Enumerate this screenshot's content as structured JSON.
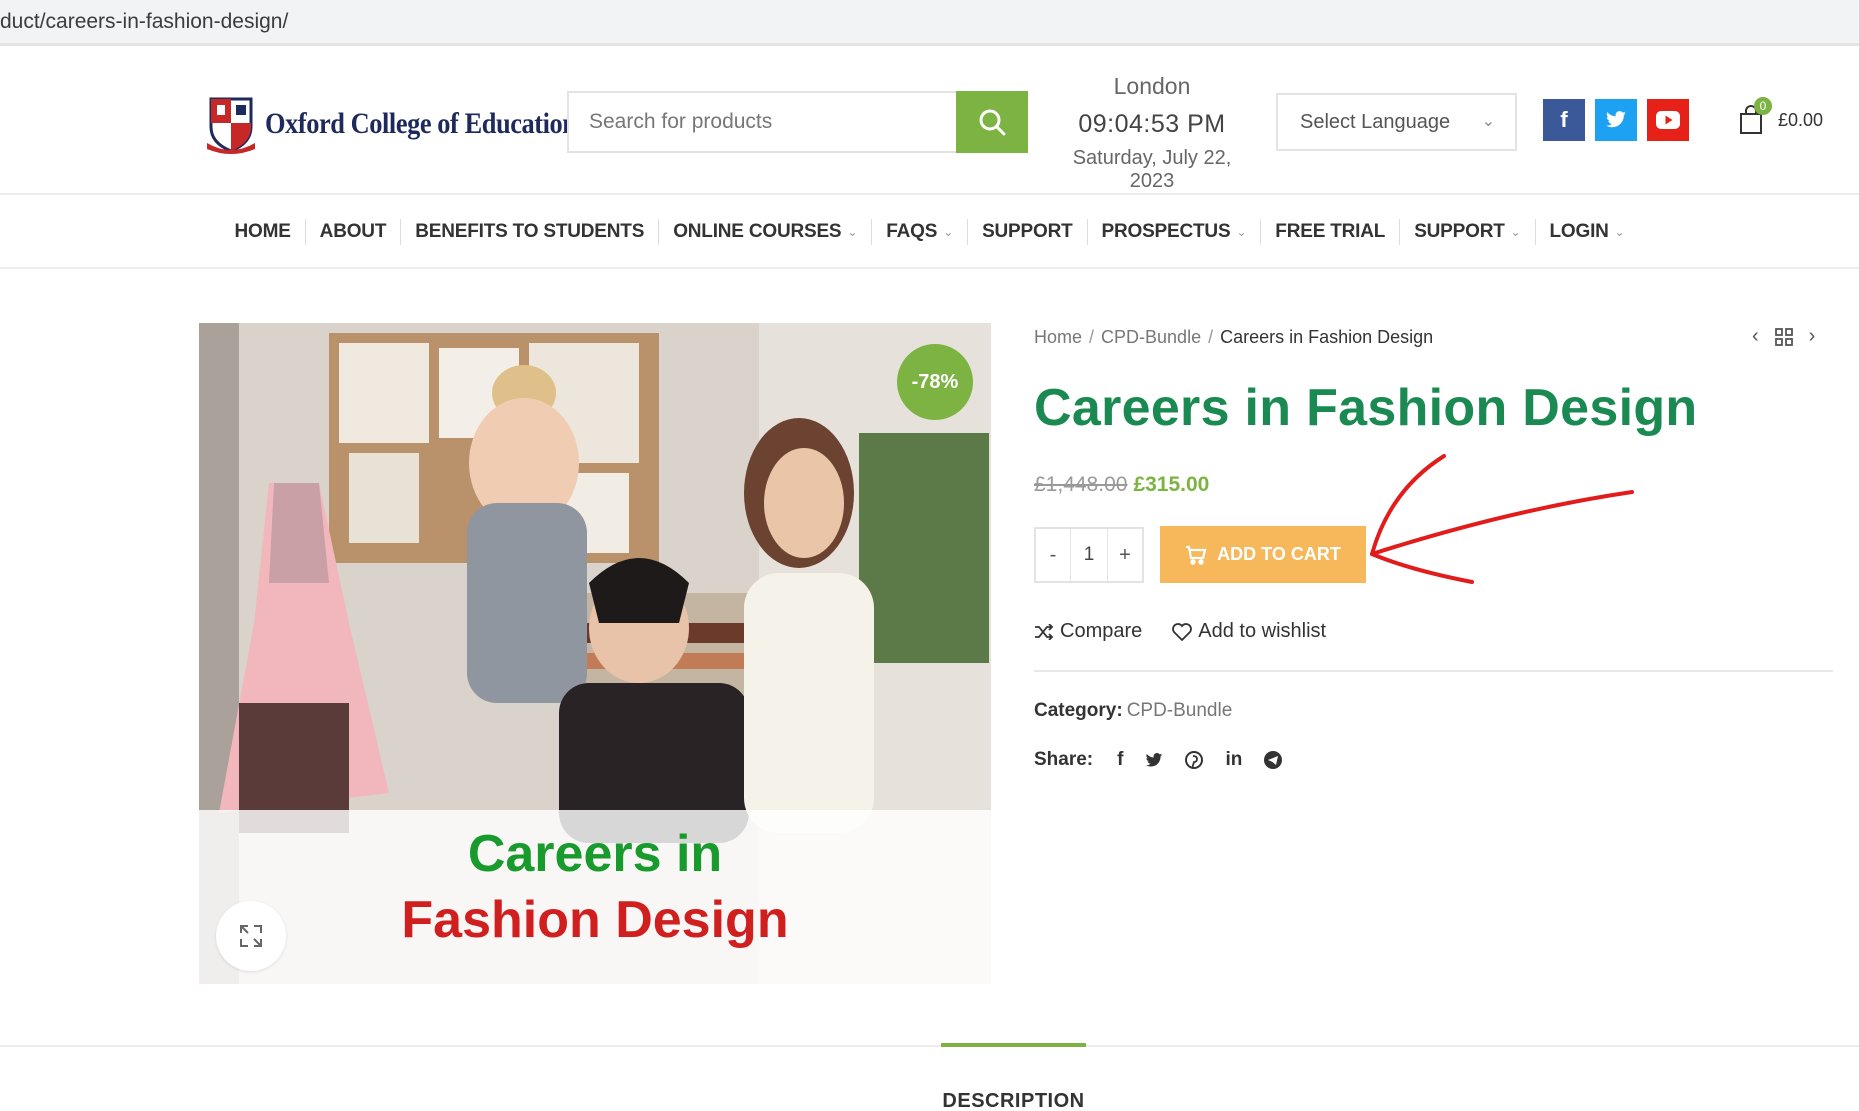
{
  "browser": {
    "url": "duct/careers-in-fashion-design/"
  },
  "header": {
    "logo_text": "Oxford College of Education",
    "search_placeholder": "Search for products",
    "clock": {
      "city": "London",
      "time": "09:04:53 PM",
      "date": "Saturday, July 22, 2023"
    },
    "language_select": "Select Language",
    "cart": {
      "count": "0",
      "total": "£0.00"
    },
    "brand_colors": {
      "accent": "#7cb342",
      "facebook": "#3b5998",
      "twitter": "#1da1f2",
      "youtube": "#e62117"
    }
  },
  "nav": {
    "items": [
      {
        "label": "HOME",
        "dropdown": false
      },
      {
        "label": "ABOUT",
        "dropdown": false
      },
      {
        "label": "BENEFITS TO STUDENTS",
        "dropdown": false
      },
      {
        "label": "ONLINE COURSES",
        "dropdown": true
      },
      {
        "label": "FAQS",
        "dropdown": true
      },
      {
        "label": "SUPPORT",
        "dropdown": false
      },
      {
        "label": "PROSPECTUS",
        "dropdown": true
      },
      {
        "label": "FREE TRIAL",
        "dropdown": false
      },
      {
        "label": "SUPPORT",
        "dropdown": true
      },
      {
        "label": "LOGIN",
        "dropdown": true
      }
    ]
  },
  "product": {
    "image_overlay_line1": "Careers in",
    "image_overlay_line2": "Fashion Design",
    "discount_badge": "-78%",
    "breadcrumb": {
      "home": "Home",
      "category": "CPD-Bundle",
      "current": "Careers in Fashion Design"
    },
    "title": "Careers in Fashion Design",
    "old_price": "£1,448.00",
    "new_price": "£315.00",
    "quantity": "1",
    "qty_minus": "-",
    "qty_plus": "+",
    "add_to_cart": "ADD TO CART",
    "compare": "Compare",
    "wishlist": "Add to wishlist",
    "category_label": "Category:",
    "category_value": "CPD-Bundle",
    "share_label": "Share:"
  },
  "tabs": {
    "active": "DESCRIPTION"
  }
}
